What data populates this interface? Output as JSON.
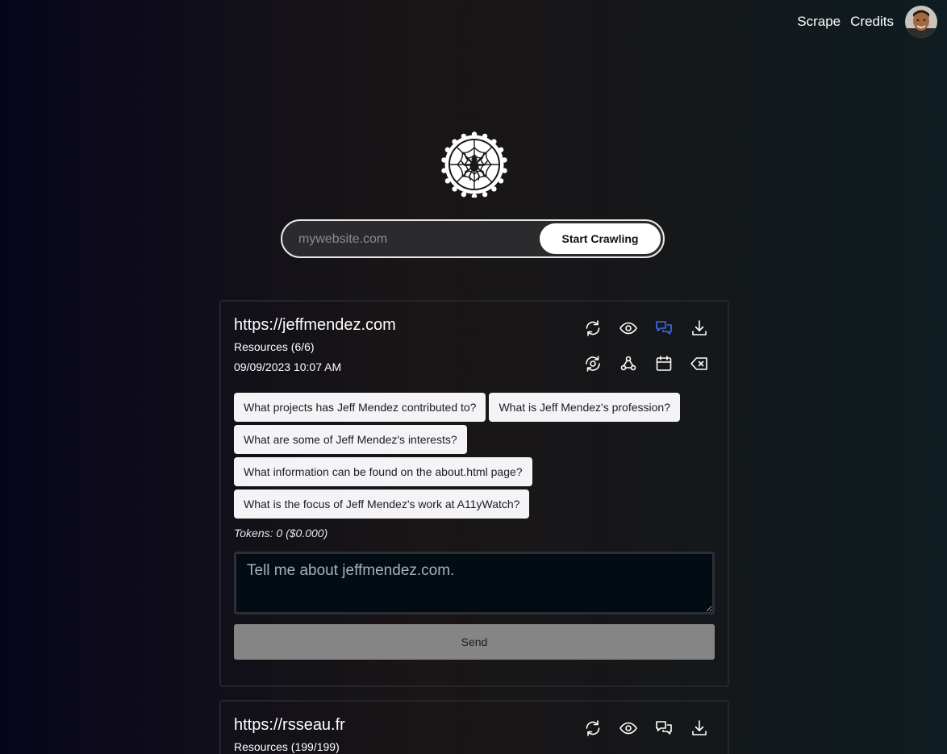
{
  "nav": {
    "scrape": "Scrape",
    "credits": "Credits"
  },
  "crawl": {
    "placeholder": "mywebsite.com",
    "button": "Start Crawling"
  },
  "sites": [
    {
      "url": "https://jeffmendez.com",
      "resources": "Resources (6/6)",
      "date": "09/09/2023 10:07 AM",
      "questions": [
        "What projects has Jeff Mendez contributed to?",
        "What is Jeff Mendez's profession?",
        "What are some of Jeff Mendez's interests?",
        "What information can be found on the about.html page?",
        "What is the focus of Jeff Mendez's work at A11yWatch?"
      ],
      "tokens": "Tokens: 0 ($0.000)",
      "chat_placeholder": "Tell me about jeffmendez.com.",
      "send": "Send",
      "icons": [
        "refresh-icon",
        "eye-icon",
        "chat-icon",
        "download-icon",
        "sync-icon",
        "webhook-icon",
        "calendar-icon",
        "delete-icon"
      ]
    },
    {
      "url": "https://rsseau.fr",
      "resources": "Resources (199/199)",
      "icons": [
        "refresh-icon",
        "eye-icon",
        "chat-icon",
        "download-icon"
      ]
    }
  ],
  "colors": {
    "accent": "#3b6ff5",
    "chip_bg": "#f4f4f6",
    "send_bg": "#858586"
  }
}
